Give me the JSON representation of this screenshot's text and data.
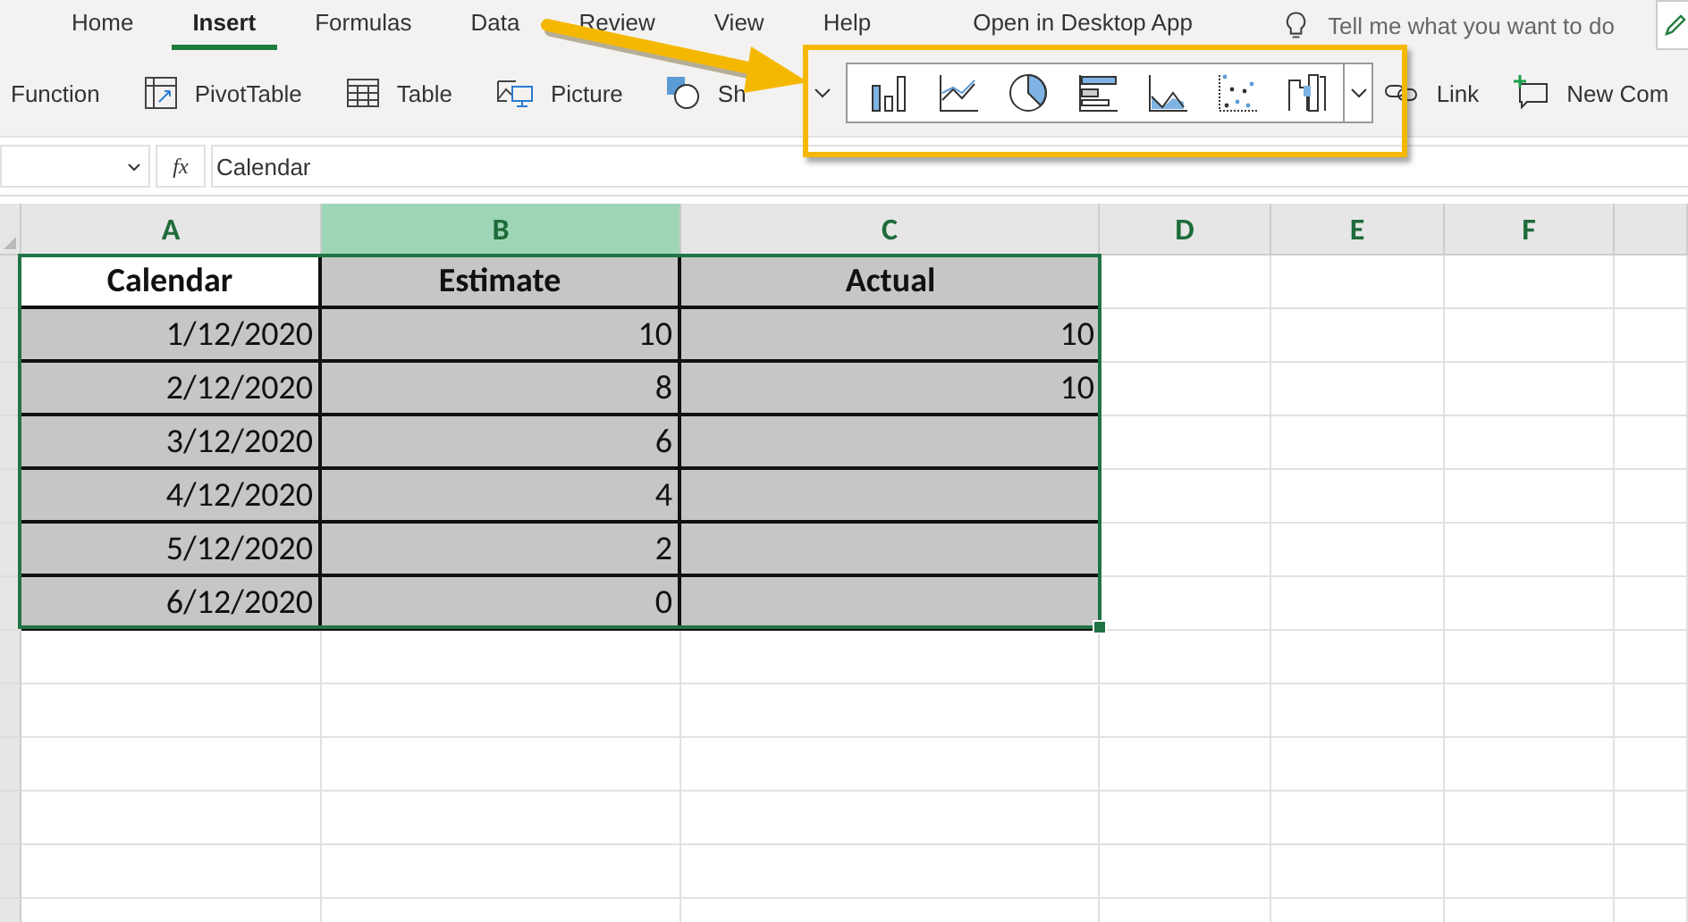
{
  "ribbon_tabs": [
    {
      "label": "Home",
      "selected": false
    },
    {
      "label": "Insert",
      "selected": true
    },
    {
      "label": "Formulas",
      "selected": false
    },
    {
      "label": "Data",
      "selected": false
    },
    {
      "label": "Review",
      "selected": false
    },
    {
      "label": "View",
      "selected": false
    },
    {
      "label": "Help",
      "selected": false
    }
  ],
  "open_in_desktop": "Open in Desktop App",
  "tell_me": {
    "placeholder": "Tell me what you want to do"
  },
  "commands_left": [
    {
      "kind": "function",
      "label": "Function"
    },
    {
      "kind": "pivot",
      "label": "PivotTable"
    },
    {
      "kind": "table",
      "label": "Table"
    },
    {
      "kind": "picture",
      "label": "Picture"
    },
    {
      "kind": "shapes",
      "label": "Sh"
    }
  ],
  "chart_gallery": [
    {
      "kind": "column"
    },
    {
      "kind": "line"
    },
    {
      "kind": "pie"
    },
    {
      "kind": "bar"
    },
    {
      "kind": "area"
    },
    {
      "kind": "scatter"
    },
    {
      "kind": "combo"
    }
  ],
  "commands_right": [
    {
      "kind": "link",
      "label": "Link"
    },
    {
      "kind": "comment",
      "label": "New Com"
    }
  ],
  "formula_bar": {
    "fx": "fx",
    "value": "Calendar"
  },
  "columns": [
    {
      "label": "A",
      "selected": false
    },
    {
      "label": "B",
      "selected": true
    },
    {
      "label": "C",
      "selected": false
    },
    {
      "label": "D",
      "selected": false
    },
    {
      "label": "E",
      "selected": false
    },
    {
      "label": "F",
      "selected": false
    }
  ],
  "table": {
    "headers": [
      {
        "text": "Calendar",
        "selected": true
      },
      {
        "text": "Estimate",
        "selected": false
      },
      {
        "text": "Actual",
        "selected": false
      }
    ],
    "rows": [
      {
        "calendar": "1/12/2020",
        "estimate": "10",
        "actual": "10"
      },
      {
        "calendar": "2/12/2020",
        "estimate": "8",
        "actual": "10"
      },
      {
        "calendar": "3/12/2020",
        "estimate": "6"
      },
      {
        "calendar": "4/12/2020",
        "estimate": "4"
      },
      {
        "calendar": "5/12/2020",
        "estimate": "2"
      },
      {
        "calendar": "6/12/2020",
        "estimate": "0"
      }
    ]
  }
}
